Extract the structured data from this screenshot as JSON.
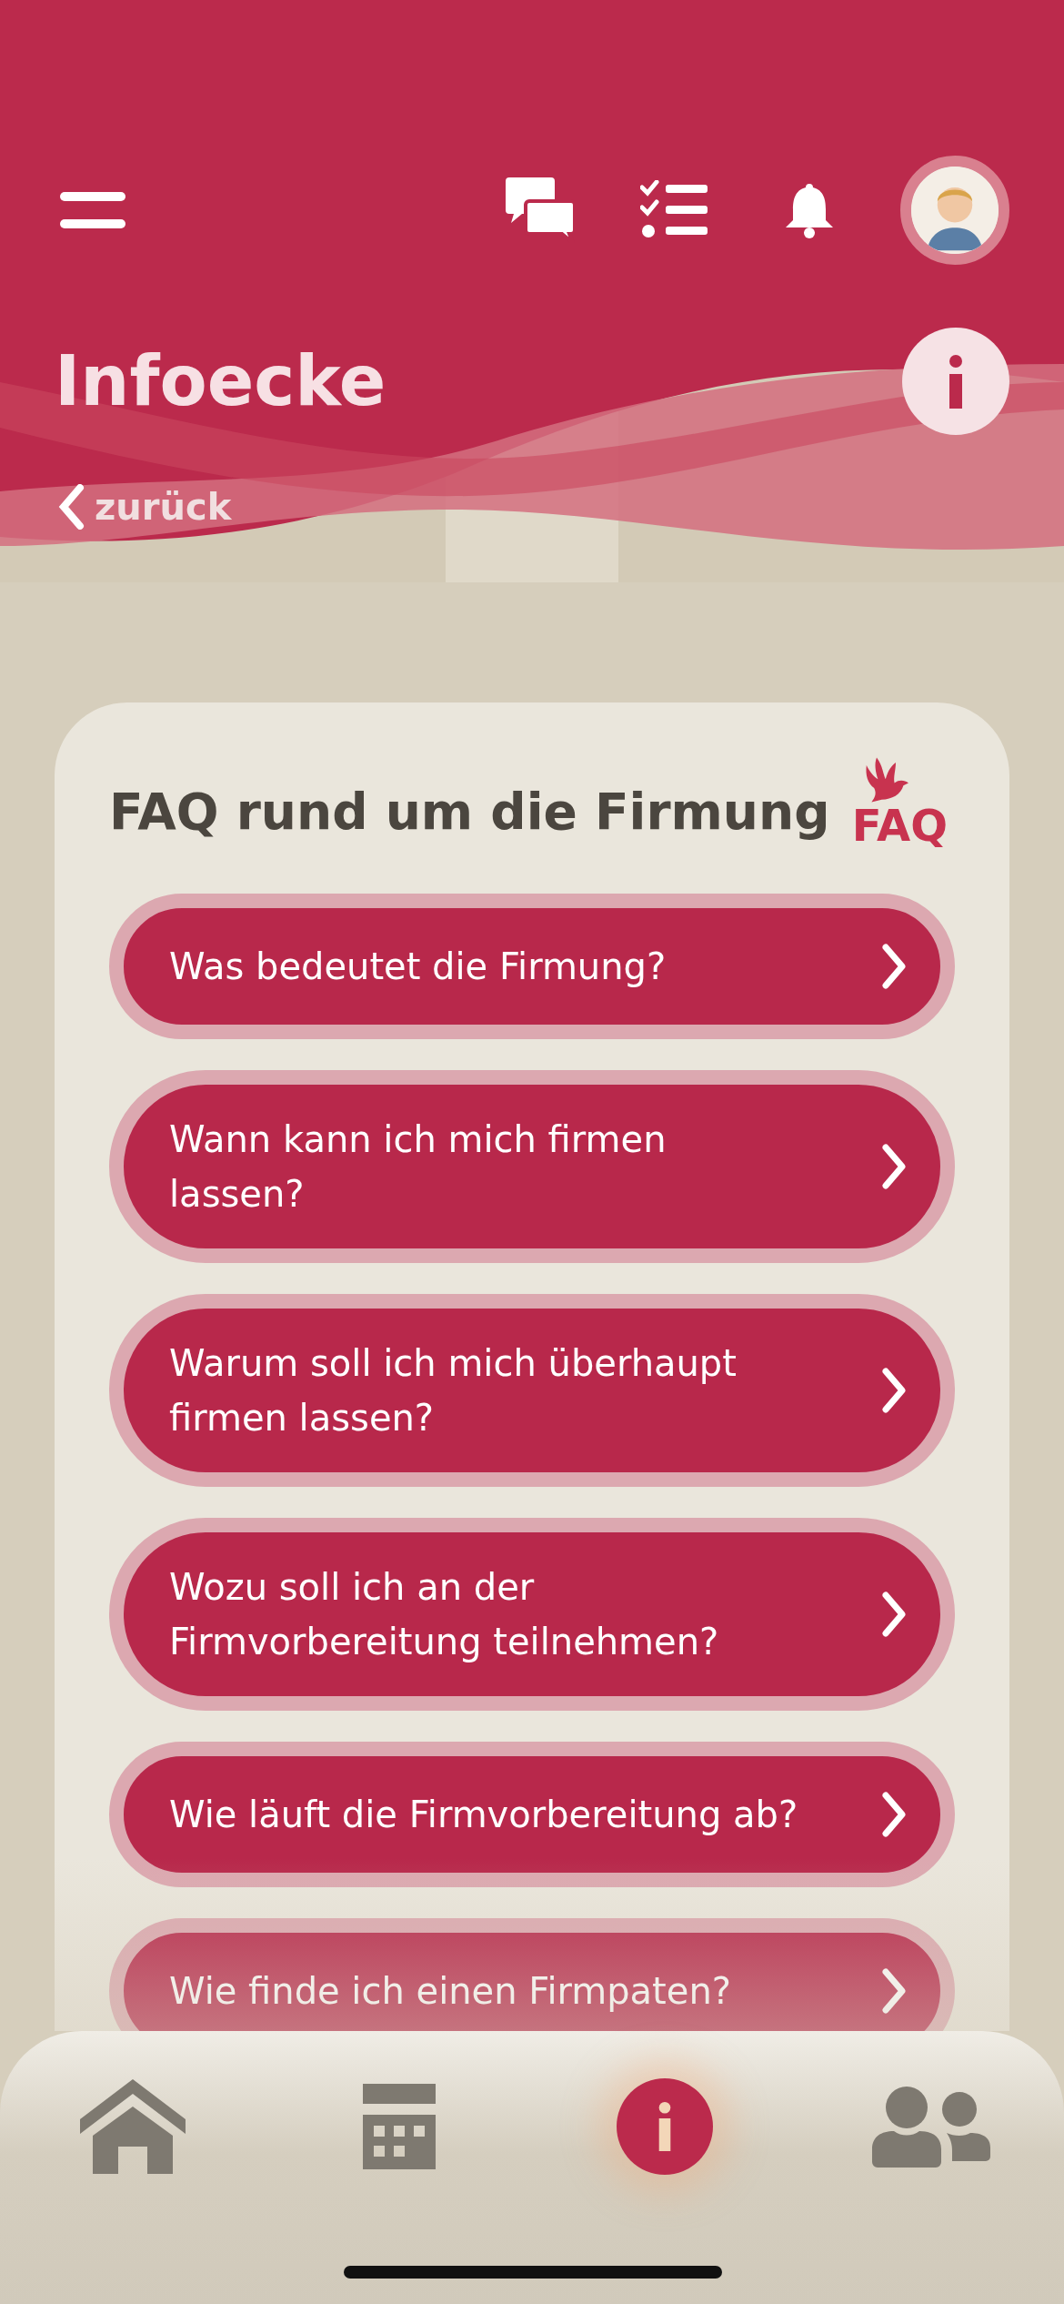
{
  "header": {
    "title": "Infoecke",
    "back_link": "zurück"
  },
  "card": {
    "title": "FAQ rund um die Firmung",
    "logo_text": "FAQ",
    "questions": [
      {
        "text": "Was bedeutet die Firmung?"
      },
      {
        "text": "Wann kann ich mich firmen lassen?"
      },
      {
        "text": "Warum soll ich mich überhaupt firmen lassen?"
      },
      {
        "text": "Wozu soll ich an der Firmvorbereitung teilnehmen?"
      },
      {
        "text": "Wie läuft die Firmvorbereitung ab?"
      },
      {
        "text": "Wie finde ich einen Firmpaten?"
      }
    ]
  },
  "bottom_nav": [
    {
      "selected": false
    },
    {
      "selected": false
    },
    {
      "selected": true
    },
    {
      "selected": false
    }
  ]
}
